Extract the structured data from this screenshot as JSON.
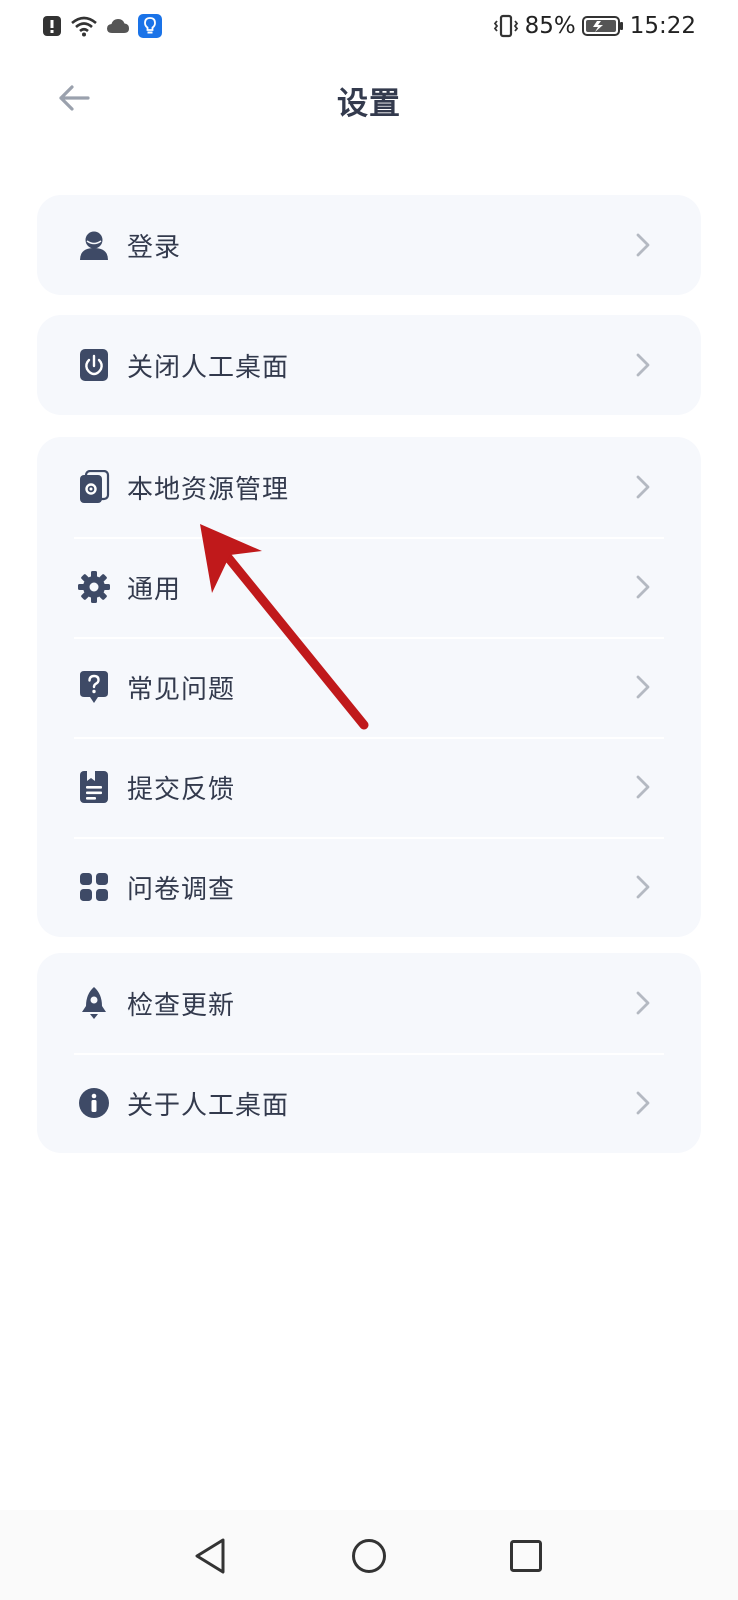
{
  "status_bar": {
    "battery_percent": "85%",
    "time": "15:22",
    "icons": [
      "alert-icon",
      "wifi-icon",
      "cloud-icon",
      "lightbulb-app-icon",
      "vibrate-icon",
      "battery-icon"
    ]
  },
  "header": {
    "title": "设置",
    "back_icon": "back-arrow-icon"
  },
  "groups": [
    {
      "items": [
        {
          "label": "登录",
          "icon": "user-icon"
        }
      ]
    },
    {
      "items": [
        {
          "label": "关闭人工桌面",
          "icon": "power-icon"
        }
      ]
    },
    {
      "items": [
        {
          "label": "本地资源管理",
          "icon": "resource-manager-icon"
        },
        {
          "label": "通用",
          "icon": "gear-icon"
        },
        {
          "label": "常见问题",
          "icon": "question-icon"
        },
        {
          "label": "提交反馈",
          "icon": "feedback-icon"
        },
        {
          "label": "问卷调查",
          "icon": "grid-icon"
        }
      ]
    },
    {
      "items": [
        {
          "label": "检查更新",
          "icon": "rocket-icon"
        },
        {
          "label": "关于人工桌面",
          "icon": "info-icon"
        }
      ]
    }
  ],
  "nav_bar": {
    "icons": [
      "back-triangle-icon",
      "home-circle-icon",
      "recents-square-icon"
    ]
  },
  "theme": {
    "icon_color": "#3e4a66",
    "card_background": "#f6f8fc",
    "annotation_color": "#c0191b"
  }
}
